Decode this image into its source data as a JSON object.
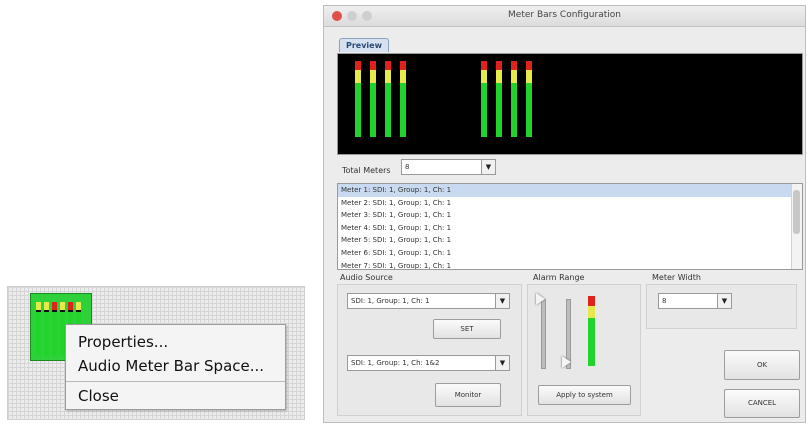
{
  "context_menu": {
    "items": [
      "Properties...",
      "Audio Meter Bar Space...",
      "Close"
    ]
  },
  "dialog": {
    "title": "Meter Bars Configuration",
    "preview_tab": "Preview",
    "total_meters_label": "Total Meters",
    "total_meters_value": "8",
    "meter_list": [
      "Meter 1: SDI: 1, Group: 1, Ch: 1",
      "Meter 2: SDI: 1, Group: 1, Ch: 1",
      "Meter 3: SDI: 1, Group: 1, Ch: 1",
      "Meter 4: SDI: 1, Group: 1, Ch: 1",
      "Meter 5: SDI: 1, Group: 1, Ch: 1",
      "Meter 6: SDI: 1, Group: 1, Ch: 1",
      "Meter 7: SDI: 1, Group: 1, Ch: 1"
    ],
    "audio_source": {
      "label": "Audio Source",
      "source_value": "SDI: 1, Group: 1, Ch: 1",
      "set_button": "SET",
      "monitor_value": "SDI: 1, Group: 1, Ch: 1&2",
      "monitor_button": "Monitor"
    },
    "alarm_range": {
      "label": "Alarm Range",
      "apply_button": "Apply to system"
    },
    "meter_width": {
      "label": "Meter Width",
      "value": "8"
    },
    "ok_button": "OK",
    "cancel_button": "CANCEL"
  },
  "colors": {
    "meter_green": "#22d32c",
    "meter_yellow": "#e7e84a",
    "meter_red": "#e0221c"
  }
}
